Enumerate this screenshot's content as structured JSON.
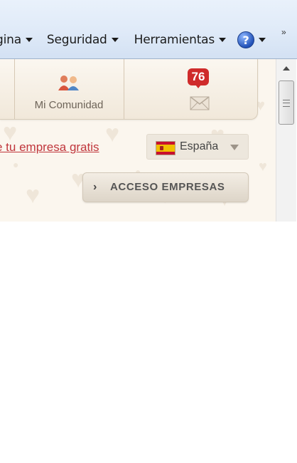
{
  "commandbar": {
    "pagina_label": "gina",
    "seguridad_label": "Seguridad",
    "herramientas_label": "Herramientas",
    "help_symbol": "?",
    "overflow_symbol": "»"
  },
  "nav": {
    "comunidad_label": "Mi Comunidad",
    "messages_count": "76"
  },
  "register_link": "e tu empresa gratis",
  "country": {
    "selected": "España"
  },
  "acceso_button": {
    "arrow": "›",
    "label": "ACCESO EMPRESAS"
  },
  "colors": {
    "link": "#c0363c",
    "badge": "#cf2b2b",
    "content_bg": "#fbf6ee"
  }
}
